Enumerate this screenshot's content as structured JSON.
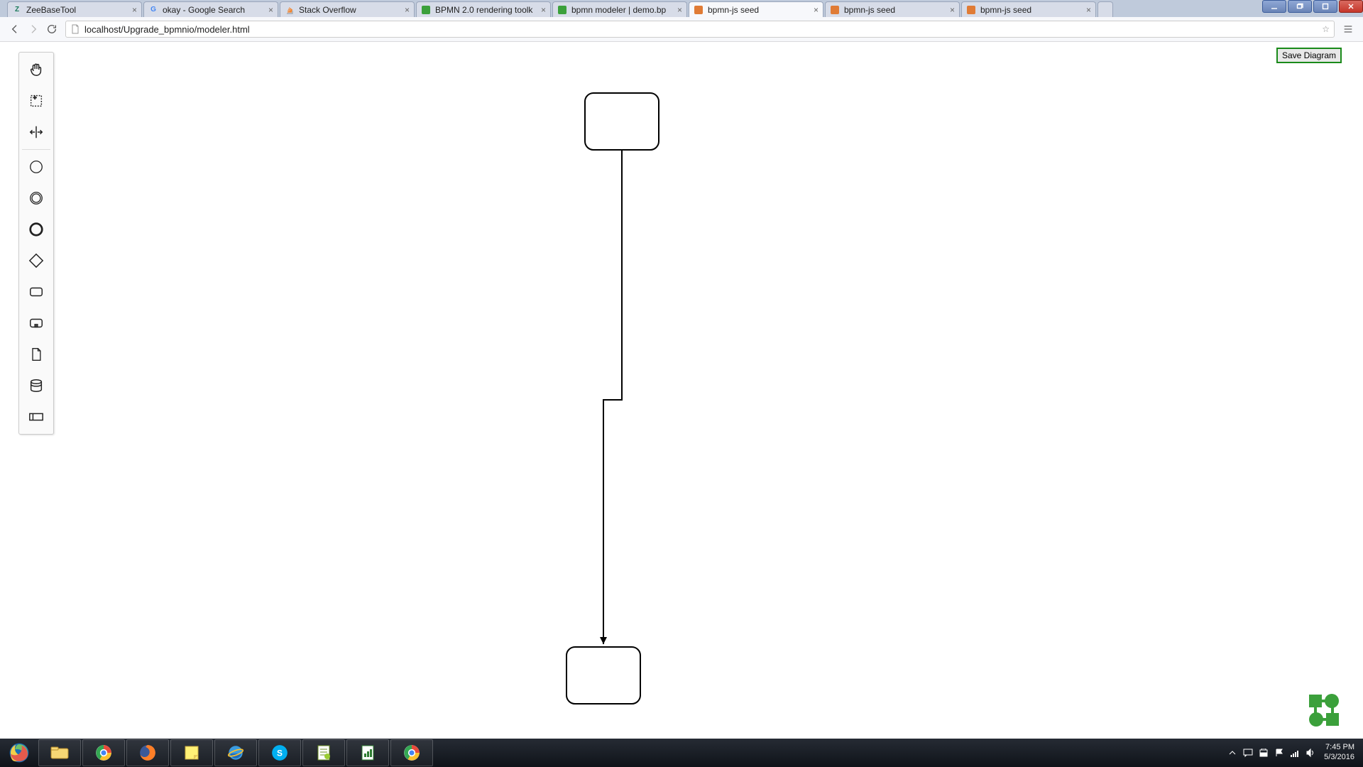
{
  "tabs": [
    {
      "label": "ZeeBaseTool",
      "favicon": "Z",
      "faviconColor": "#1b7a5a"
    },
    {
      "label": "okay - Google Search",
      "favicon": "G",
      "faviconColor": "#4285F4"
    },
    {
      "label": "Stack Overflow",
      "favicon": "so",
      "faviconColor": "#f48024"
    },
    {
      "label": "BPMN 2.0 rendering toolk",
      "favicon": "green",
      "faviconColor": "#3ba03b"
    },
    {
      "label": "bpmn modeler | demo.bp",
      "favicon": "green",
      "faviconColor": "#3ba03b"
    },
    {
      "label": "bpmn-js seed",
      "favicon": "orange",
      "faviconColor": "#e07b35",
      "active": true
    },
    {
      "label": "bpmn-js seed",
      "favicon": "orange",
      "faviconColor": "#e07b35"
    },
    {
      "label": "bpmn-js seed",
      "favicon": "orange",
      "faviconColor": "#e07b35"
    }
  ],
  "url": "localhost/Upgrade_bpmnio/modeler.html",
  "saveButtonLabel": "Save Diagram",
  "palette": [
    {
      "name": "hand-tool-icon",
      "title": "Hand tool"
    },
    {
      "name": "lasso-tool-icon",
      "title": "Lasso tool"
    },
    {
      "name": "space-tool-icon",
      "title": "Space tool"
    },
    {
      "name": "start-event-icon",
      "title": "Start event"
    },
    {
      "name": "intermediate-event-icon",
      "title": "Intermediate event"
    },
    {
      "name": "end-event-icon",
      "title": "End event"
    },
    {
      "name": "gateway-icon",
      "title": "Gateway"
    },
    {
      "name": "task-icon",
      "title": "Task"
    },
    {
      "name": "subprocess-icon",
      "title": "Subprocess"
    },
    {
      "name": "data-object-icon",
      "title": "Data object"
    },
    {
      "name": "data-store-icon",
      "title": "Data store"
    },
    {
      "name": "participant-icon",
      "title": "Participant"
    }
  ],
  "clock": {
    "time": "7:45 PM",
    "date": "5/3/2016"
  }
}
